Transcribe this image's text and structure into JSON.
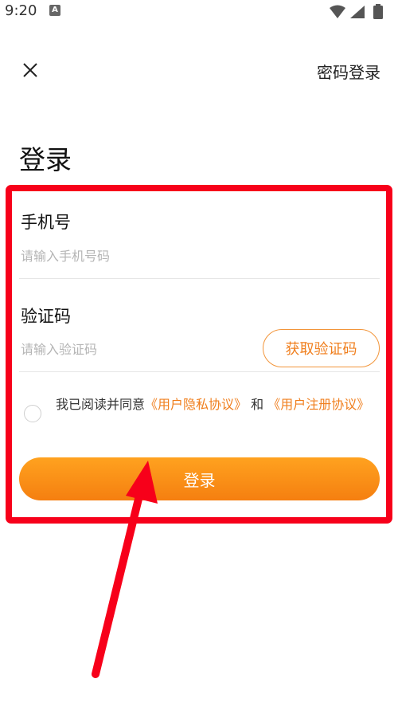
{
  "status_bar": {
    "time": "9:20",
    "notification_badge": "A",
    "icons": [
      "wifi-icon",
      "signal-icon",
      "battery-icon"
    ]
  },
  "header": {
    "close_icon": "close-icon",
    "password_login": "密码登录"
  },
  "title": "登录",
  "phone": {
    "label": "手机号",
    "placeholder": "请输入手机号码",
    "value": ""
  },
  "code": {
    "label": "验证码",
    "placeholder": "请输入验证码",
    "value": "",
    "get_code_button": "获取验证码"
  },
  "agreement": {
    "checked": false,
    "text_prefix": "我已阅读并同意",
    "privacy_link": "《用户隐私协议》",
    "conjunction": "和",
    "register_link": "《用户注册协议》"
  },
  "login_button": "登录",
  "colors": {
    "accent": "#f07f1e",
    "button_gradient_top": "#ffa21f",
    "button_gradient_bottom": "#f57f10",
    "annotation_red": "#f7001a"
  }
}
